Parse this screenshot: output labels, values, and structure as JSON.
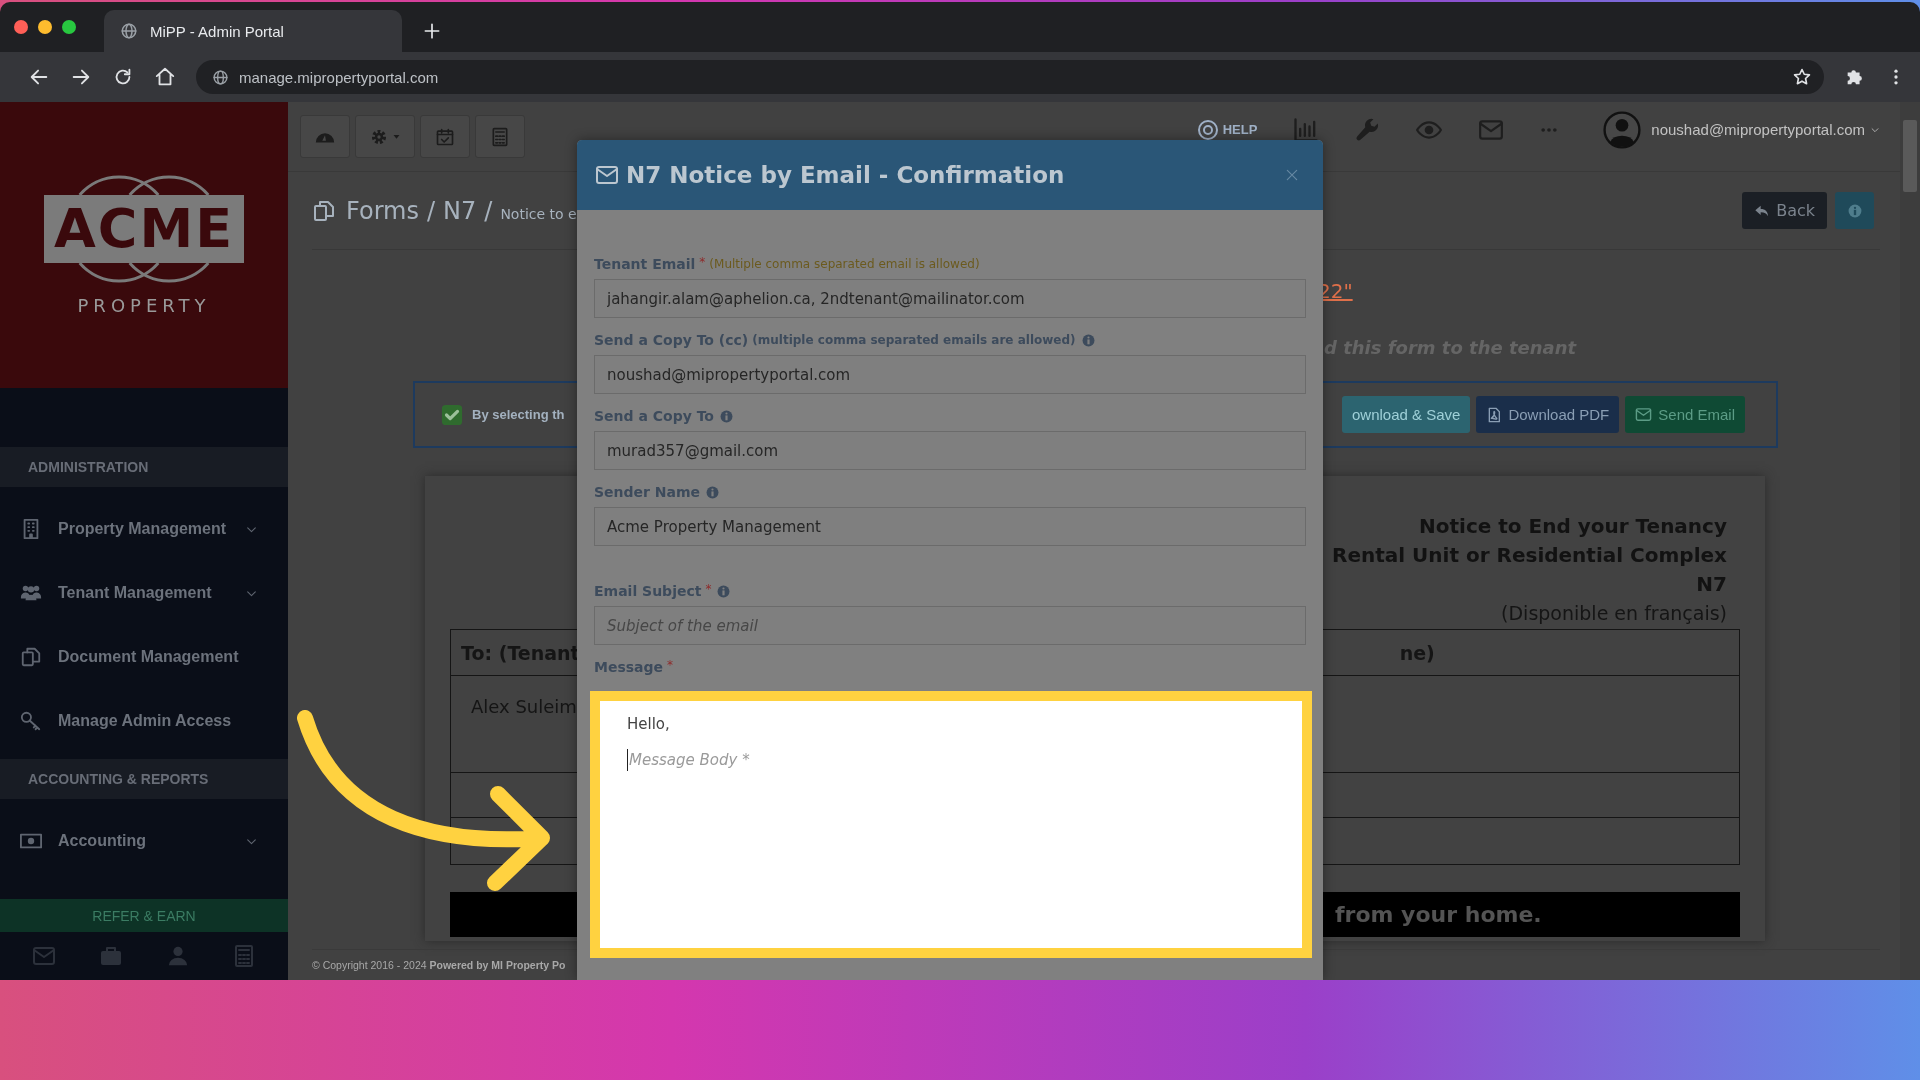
{
  "browser": {
    "tab_title": "MiPP - Admin Portal",
    "url": "manage.mipropertyportal.com"
  },
  "sidebar": {
    "logo": {
      "wordmark": "ACME",
      "tagline": "PROPERTY"
    },
    "sections": [
      {
        "title": "ADMINISTRATION",
        "items": [
          {
            "label": "Property Management",
            "submenu": true
          },
          {
            "label": "Tenant Management",
            "submenu": true
          },
          {
            "label": "Document Management",
            "submenu": false
          },
          {
            "label": "Manage Admin Access",
            "submenu": false
          }
        ]
      },
      {
        "title": "ACCOUNTING & REPORTS",
        "items": [
          {
            "label": "Accounting",
            "submenu": true
          }
        ]
      }
    ],
    "refer_button": "REFER & EARN"
  },
  "topnav": {
    "help_label": "HELP",
    "user_email": "noushad@mipropertyportal.com"
  },
  "breadcrumb": [
    {
      "text": "Forms",
      "kind": "crumb"
    },
    {
      "text": "/",
      "kind": "sep"
    },
    {
      "text": "N7",
      "kind": "crumb"
    },
    {
      "text": "/",
      "kind": "sep"
    },
    {
      "text": "Notice to e",
      "kind": "current"
    }
  ],
  "header_buttons": [
    {
      "label": "Back",
      "kind": "back"
    },
    {
      "kind": "info"
    }
  ],
  "notice": {
    "link_fragment": "22\"",
    "instruction": "d this form to the tenant"
  },
  "consent": {
    "checked": true,
    "text": "By selecting th"
  },
  "actions": [
    {
      "label": "ownload & Save",
      "kind": "save"
    },
    {
      "label": "Download PDF",
      "kind": "pdf"
    },
    {
      "label": "Send Email",
      "kind": "email"
    }
  ],
  "document": {
    "title_lines": [
      "Notice to End your Tenancy",
      "Rental Unit or Residential Complex",
      "N7"
    ],
    "subtitle": "(Disponible en français)",
    "table_header_left": "To: (Tenant",
    "table_header_right": "ne)",
    "tenant_name": "Alex Suleim",
    "banner": "from your home."
  },
  "footer": "© Copyright 2016 - 2024 **Powered by MI Property Po**",
  "modal": {
    "title": "N7 Notice by Email - Confirmation",
    "fields": [
      {
        "label": "Tenant Email",
        "required_mark": "*",
        "hint": {
          "text": "(Multiple comma separated email is allowed)",
          "kind": "note"
        },
        "info": false,
        "value": "jahangir.alam@aphelion.ca, 2ndtenant@mailinator.com"
      },
      {
        "label": "Send a Copy To (cc)",
        "hint": {
          "text": "(multiple comma separated emails are allowed)",
          "kind": "strong"
        },
        "info": true,
        "value": "noushad@mipropertyportal.com"
      },
      {
        "label": "Send a Copy To",
        "info": true,
        "value": "murad357@gmail.com"
      },
      {
        "label": "Sender Name",
        "info": true,
        "value": "Acme Property Management"
      },
      {
        "label": "Email Subject",
        "required_mark": "*",
        "info": true,
        "placeholder": "Subject of the email"
      }
    ],
    "message": {
      "label": "Message",
      "required_mark": "*",
      "greeting": "Hello,",
      "placeholder": "Message Body *"
    }
  }
}
